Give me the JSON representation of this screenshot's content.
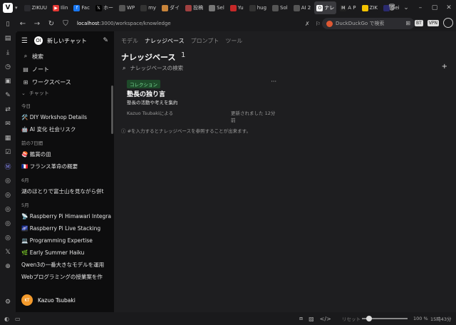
{
  "browser": {
    "logo": "V",
    "tabs": [
      {
        "label": "ZIKUU",
        "icon": "person",
        "color": "#2a2a2e"
      },
      {
        "label": "Ilin",
        "icon": "youtube",
        "color": "#e53935"
      },
      {
        "label": "Fac",
        "icon": "facebook",
        "color": "#1877f2"
      },
      {
        "label": "ホー",
        "icon": "x",
        "color": "#000000"
      },
      {
        "label": "WP",
        "icon": "doc",
        "color": "#555555"
      },
      {
        "label": "my",
        "icon": "github",
        "color": "#333333"
      },
      {
        "label": "ダイ",
        "icon": "img",
        "color": "#c8843a"
      },
      {
        "label": "投稿",
        "icon": "img",
        "color": "#a04040"
      },
      {
        "label": "Sel",
        "icon": "img",
        "color": "#777777"
      },
      {
        "label": "Yu",
        "icon": "img",
        "color": "#c62828"
      },
      {
        "label": "hug",
        "icon": "github",
        "color": "#333333"
      },
      {
        "label": "Sol",
        "icon": "gear",
        "color": "#555555"
      },
      {
        "label": "AI 2",
        "icon": "gear",
        "color": "#555555"
      },
      {
        "label": "ナレ",
        "icon": "openwebui",
        "color": "#ffffff",
        "active": true
      },
      {
        "label": "A P",
        "icon": "M",
        "color": "#222222"
      },
      {
        "label": "ZIK",
        "icon": "doc",
        "color": "#f2c200"
      },
      {
        "label": "Gei",
        "icon": "gemini",
        "color": "#2a2a6e"
      }
    ],
    "url_host": "localhost",
    "url_path": ":3000/workspace/knowledge",
    "search_placeholder": "DuckDuckGo で検索",
    "badge_bt": "BT",
    "badge_vpn": "VPN"
  },
  "sidebar": {
    "new_chat": "新しいチャット",
    "nav": [
      {
        "label": "検索",
        "icon": "search-icon"
      },
      {
        "label": "ノート",
        "icon": "note-icon"
      },
      {
        "label": "ワークスペース",
        "icon": "workspace-icon"
      }
    ],
    "chat_section": "チャット",
    "groups": [
      {
        "label": "今日",
        "items": [
          "🛠️ DIY Workshop Details",
          "🤖 AI 変化 社会リスク"
        ]
      },
      {
        "label": "前の7日間",
        "items": [
          "🍣 鑑賞の皿",
          "🇫🇷 フランス革命の概要"
        ]
      },
      {
        "label": "6月",
        "items": [
          "湖のほとりで富士山を見ながら併t"
        ]
      },
      {
        "label": "5月",
        "items": [
          "📡 Raspberry Pi Himawari Integra",
          "🌌 Raspberry Pi Live Stacking",
          "💻 Programming Expertise",
          "🌿 Early Summer Haiku",
          "Qwen3の一番大きなモデルを運用",
          "Webプログラミングの授業案を作"
        ]
      }
    ],
    "user_initials": "KT",
    "user_name": "Kazuo Tsubaki"
  },
  "main": {
    "tabs": [
      {
        "label": "モデル",
        "active": false
      },
      {
        "label": "ナレッジベース",
        "active": true
      },
      {
        "label": "プロンプト",
        "active": false
      },
      {
        "label": "ツール",
        "active": false
      }
    ],
    "title": "ナレッジベース",
    "count": "1",
    "search_placeholder": "ナレッジベースの検索",
    "card": {
      "tag": "コレクション",
      "title": "塾長の独り言",
      "description": "塾長の活動や考えを集約",
      "author": "Kazuo Tsubakiによる",
      "updated": "更新されました 12分前"
    },
    "hint": "ⓘ #を入力するとナレッジベースを参照することが出来ます。"
  },
  "status": {
    "reset": "リセット",
    "zoom": "100 %",
    "clock": "15時43分",
    "zoom_level": 0.1
  }
}
